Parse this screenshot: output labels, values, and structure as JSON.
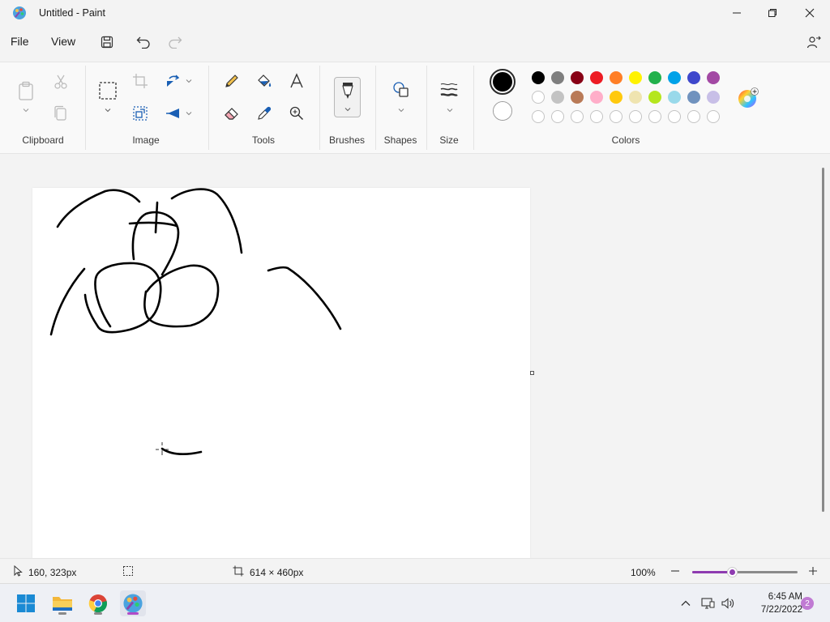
{
  "window": {
    "title": "Untitled - Paint",
    "app_icon": "paint-palette-icon"
  },
  "menu": {
    "file": "File",
    "view": "View",
    "icons": [
      "save-icon",
      "undo-icon",
      "redo-icon",
      "share-icon"
    ]
  },
  "ribbon": {
    "groups": {
      "clipboard": "Clipboard",
      "image": "Image",
      "tools": "Tools",
      "brushes": "Brushes",
      "shapes": "Shapes",
      "size": "Size",
      "colors": "Colors"
    },
    "primary_color": "#000000",
    "secondary_color": "#ffffff",
    "palette_row1": [
      "#000000",
      "#7f7f7f",
      "#880015",
      "#ed1c24",
      "#ff7f27",
      "#fff200",
      "#22b14c",
      "#00a2e8",
      "#3f48cc",
      "#a349a4"
    ],
    "palette_row2": [
      "#ffffff",
      "#c3c3c3",
      "#b97a57",
      "#ffaec9",
      "#ffc90e",
      "#efe4b0",
      "#b5e61d",
      "#99d9ea",
      "#7092be",
      "#c8bfe7"
    ]
  },
  "status": {
    "cursor_position": "160, 323px",
    "canvas_size": "614 × 460px",
    "zoom": "100%",
    "zoom_level": 0.38
  },
  "taskbar": {
    "time": "6:45 AM",
    "date": "7/22/2022",
    "notifications": "2"
  }
}
